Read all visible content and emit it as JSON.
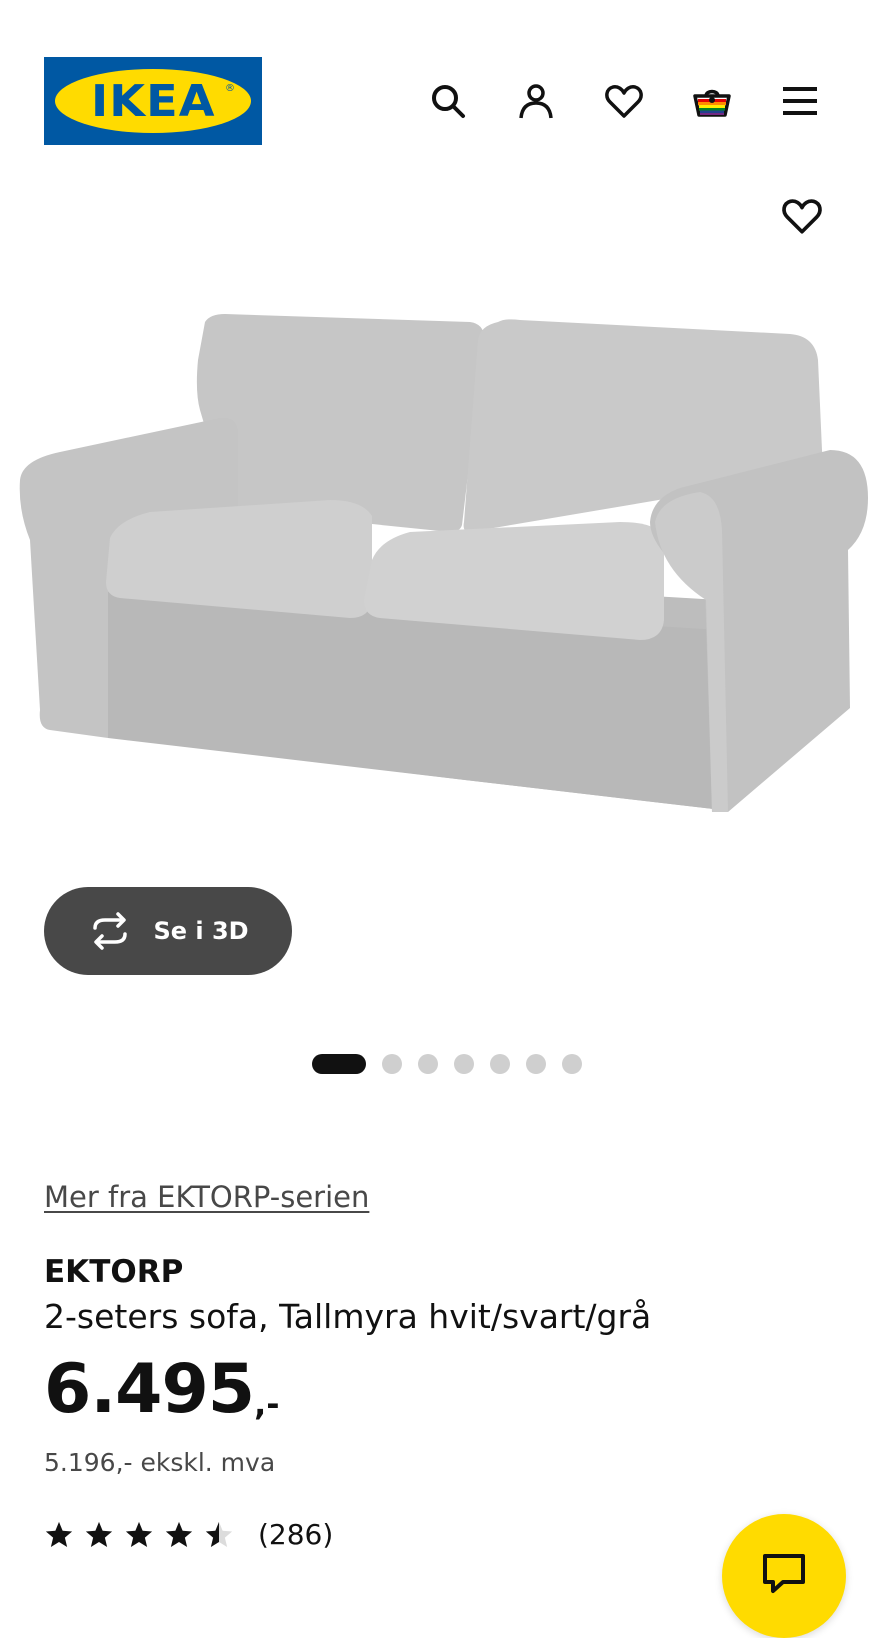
{
  "header": {
    "logo_text": "IKEA",
    "logo_registered": "®",
    "icons": [
      "search-icon",
      "account-icon",
      "heart-icon",
      "basket-icon",
      "menu-icon"
    ]
  },
  "gallery": {
    "view_3d_label": "Se i 3D",
    "slide_count": 7,
    "active_slide": 1
  },
  "product": {
    "series_link": "Mer fra EKTORP-serien",
    "name": "EKTORP",
    "description": "2-seters sofa, Tallmyra hvit/svart/grå",
    "price_main": "6.495",
    "price_suffix": ",-",
    "price_ex_vat": "5.196,- ekskl. mva",
    "rating": 4.5,
    "review_count": "(286)"
  },
  "colors": {
    "brand_blue": "#0058a3",
    "brand_yellow": "#ffdb00",
    "button_dark": "#484848",
    "text": "#111111"
  }
}
